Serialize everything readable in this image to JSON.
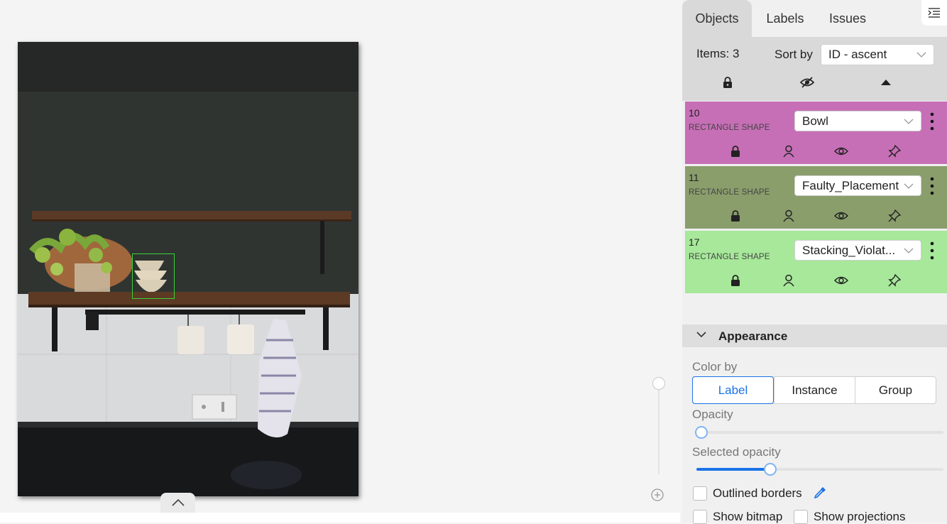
{
  "canvas": {
    "image_alt": "Kitchen wall shelves with bowls, mugs and a towel",
    "bbox_color": "#39d339"
  },
  "panel": {
    "tabs": [
      {
        "label": "Objects",
        "active": true
      },
      {
        "label": "Labels",
        "active": false
      },
      {
        "label": "Issues",
        "active": false
      }
    ],
    "items_label": "Items: 3",
    "sort_label": "Sort by",
    "sort_value": "ID - ascent",
    "objects": [
      {
        "id": "10",
        "type": "RECTANGLE SHAPE",
        "label": "Bowl",
        "color": "#c66fb6"
      },
      {
        "id": "11",
        "type": "RECTANGLE SHAPE",
        "label": "Faulty_Placement",
        "color": "#8a9e6c"
      },
      {
        "id": "17",
        "type": "RECTANGLE SHAPE",
        "label": "Stacking_Violat...",
        "color": "#a7e89a"
      }
    ],
    "appearance": {
      "title": "Appearance",
      "color_by_label": "Color by",
      "color_by_options": [
        "Label",
        "Instance",
        "Group"
      ],
      "color_by_selected": "Label",
      "opacity_label": "Opacity",
      "opacity_value": 0.02,
      "selected_opacity_label": "Selected opacity",
      "selected_opacity_value": 0.3,
      "outlined_borders_label": "Outlined borders",
      "show_bitmap_label": "Show bitmap",
      "show_projections_label": "Show projections"
    },
    "accent_color": "#1a73e8"
  }
}
